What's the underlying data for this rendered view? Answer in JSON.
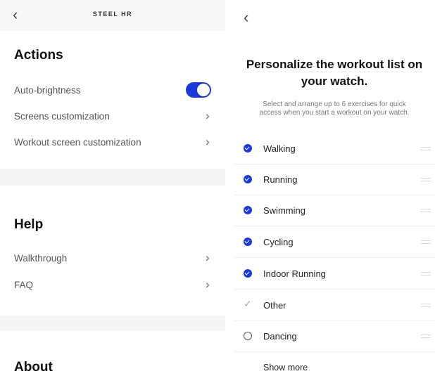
{
  "left": {
    "device_title": "STEEL HR",
    "back_glyph": "‹",
    "actions_title": "Actions",
    "actions": [
      {
        "label": "Auto-brightness",
        "control": "toggle",
        "on": true
      },
      {
        "label": "Screens customization",
        "control": "chevron"
      },
      {
        "label": "Workout screen customization",
        "control": "chevron"
      }
    ],
    "help_title": "Help",
    "help": [
      {
        "label": "Walkthrough",
        "control": "chevron"
      },
      {
        "label": "FAQ",
        "control": "chevron"
      }
    ],
    "about_title": "About",
    "chevron_glyph": "›"
  },
  "right": {
    "back_glyph": "‹",
    "headline_line1": "Personalize the workout list on",
    "headline_line2": "your watch.",
    "description_line1": "Select and arrange up to 6 exercises for quick",
    "description_line2": "access when you start a workout on your watch.",
    "workouts": [
      {
        "label": "Walking",
        "state": "checked"
      },
      {
        "label": "Running",
        "state": "checked"
      },
      {
        "label": "Swimming",
        "state": "checked"
      },
      {
        "label": "Cycling",
        "state": "checked"
      },
      {
        "label": "Indoor Running",
        "state": "checked"
      },
      {
        "label": "Other",
        "state": "tick"
      },
      {
        "label": "Dancing",
        "state": "unchecked"
      }
    ],
    "tick_glyph": "✓",
    "show_more": "Show more"
  },
  "colors": {
    "accent": "#1a39d6",
    "separator": "#f4f4f5",
    "topbar": "#f6f6f7"
  }
}
